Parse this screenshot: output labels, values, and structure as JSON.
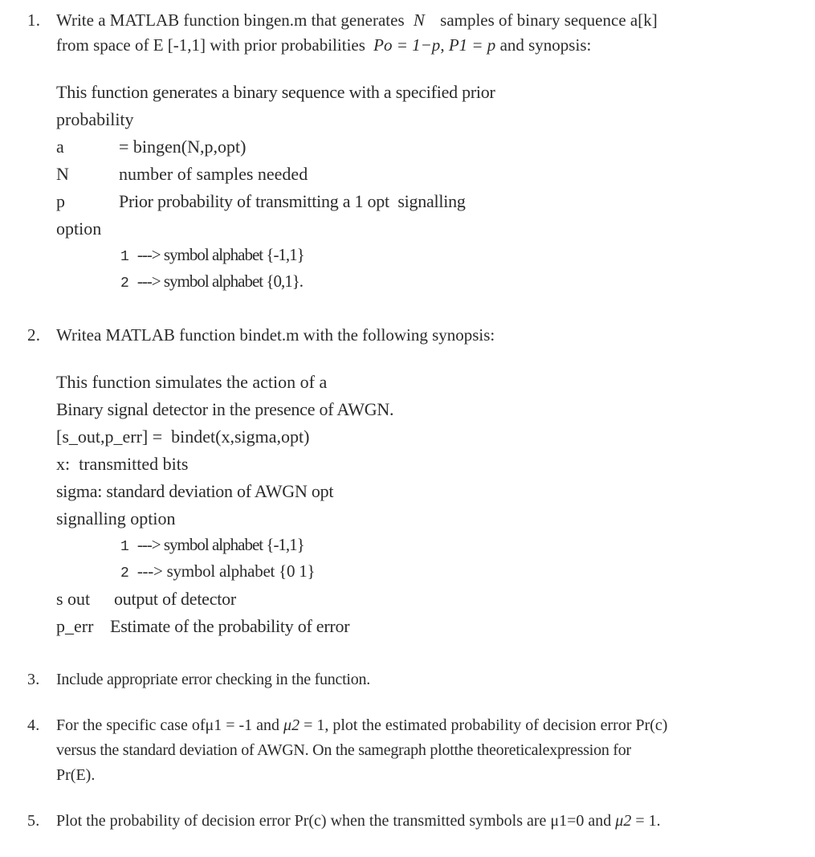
{
  "document": {
    "type": "assignment-problem-list",
    "text_color": "#2b2b2b",
    "background_color": "#ffffff",
    "items": [
      {
        "number": "1.",
        "lines": [
          "Write a MATLAB function bingen.m that generates",
          "samples of binary sequence a[k]",
          "from space of  E [-1,1] with prior probabilities",
          ", ",
          " and synopsis:"
        ],
        "italic_N": "N",
        "italic_P0": "Po = 1−p",
        "italic_P1": "P1 = p"
      },
      {
        "number": "2.",
        "line": "Writea MATLAB function bindet.m with the following synopsis:"
      },
      {
        "number": "3.",
        "line": "Include appropriate error checking in the function."
      },
      {
        "number": "4.",
        "line_a_pre": "For the specific case ofμ1 = -1  and ",
        "line_a_mu2": "μ2",
        "line_a_post": "  =  1,  plot the estimated probability of decision error Pr(c)",
        "line_b": "versus the standard  deviation  of AWGN. On the samegraph plotthe theoreticalexpression for",
        "line_c": "Pr(E)."
      },
      {
        "number": "5.",
        "line_pre": "Plot the probability of decision error Pr(c) when the transmitted symbols are  μ1=0  and ",
        "line_mu2": "μ2",
        "line_post": " = 1."
      }
    ]
  },
  "synopsis_bingen": {
    "l1": "This function generates a binary sequence with a specified prior",
    "l2": "probability",
    "l3_label": "a",
    "l3_text": "= bingen(N,p,opt)",
    "l4_label": "N",
    "l4_text": "number of samples needed",
    "l5_label": "p",
    "l5_text": "Prior probability of transmitting a 1 opt  signalling",
    "l6": "option",
    "opt1_num": "1",
    "opt1_text": "---> symbol alphabet {-1,1}",
    "opt2_num": "2",
    "opt2_text": "---> symbol alphabet {0,1}."
  },
  "synopsis_bindet": {
    "l1": "This function simulates the action of a",
    "l2": "Binary signal detector in the presence of AWGN.",
    "l3": "[s_out,p_err] =  bindet(x,sigma,opt)",
    "l4": "x:  transmitted bits",
    "l5": "sigma: standard deviation of AWGN opt",
    "l6": "signalling option",
    "opt1_num": "1",
    "opt1_text": "---> symbol alphabet {-1,1}",
    "opt2_num": "2",
    "opt2_text": "---> symbol alphabet {0 1}",
    "l7_label": "s out",
    "l7_text": "output of detector",
    "l8_label": "p_err",
    "l8_text": "Estimate of the probability of error"
  }
}
